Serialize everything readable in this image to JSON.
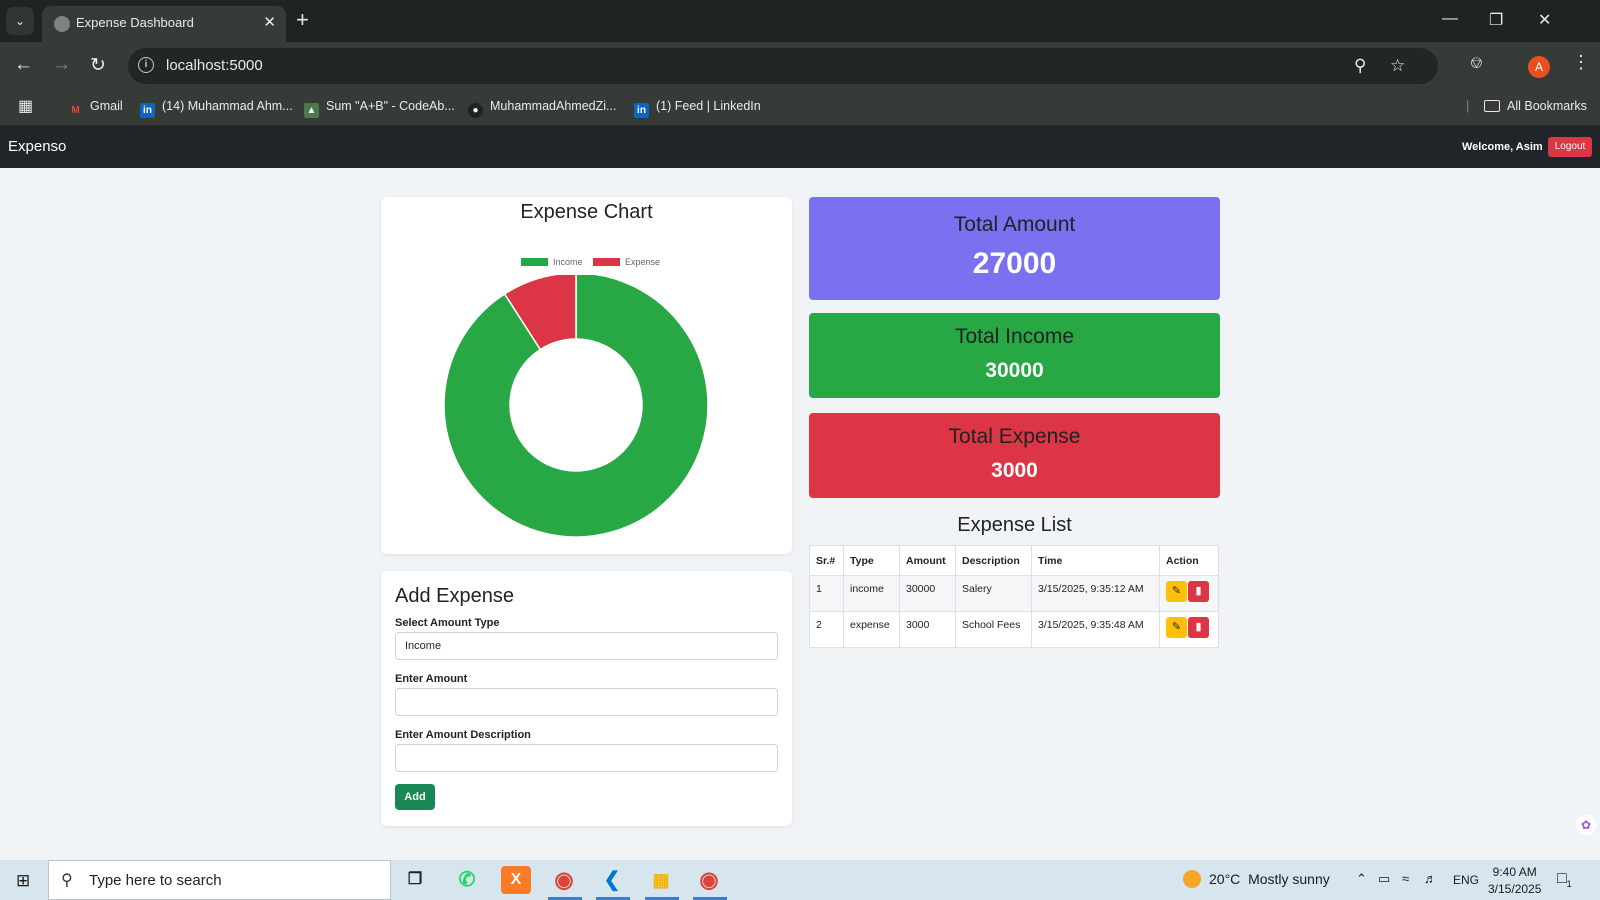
{
  "browser": {
    "tab_title": "Expense Dashboard",
    "url": "localhost:5000",
    "profile_initial": "A",
    "bookmarks": [
      {
        "label": "Gmail",
        "icon": "gmail-icon"
      },
      {
        "label": "(14) Muhammad Ahm...",
        "icon": "linkedin-icon"
      },
      {
        "label": "Sum \"A+B\" - CodeAb...",
        "icon": "codeabbey-icon"
      },
      {
        "label": "MuhammadAhmedZi...",
        "icon": "github-icon"
      },
      {
        "label": "(1) Feed | LinkedIn",
        "icon": "linkedin-icon"
      }
    ],
    "all_bookmarks_label": "All Bookmarks"
  },
  "app": {
    "brand": "Expenso",
    "welcome": "Welcome, Asim",
    "logout_label": "Logout"
  },
  "chart_card": {
    "title": "Expense Chart"
  },
  "chart_data": {
    "type": "pie",
    "style": "doughnut",
    "categories": [
      "Income",
      "Expense"
    ],
    "values": [
      30000,
      3000
    ],
    "colors": [
      "#28a745",
      "#dc3545"
    ],
    "legend_position": "top"
  },
  "summary": {
    "total_amount": {
      "label": "Total Amount",
      "value": "27000",
      "color": "#7b71f0"
    },
    "total_income": {
      "label": "Total Income",
      "value": "30000",
      "color": "#28a745"
    },
    "total_expense": {
      "label": "Total Expense",
      "value": "3000",
      "color": "#dc3545"
    }
  },
  "form": {
    "title": "Add Expense",
    "type_label": "Select Amount Type",
    "type_value": "Income",
    "amount_label": "Enter Amount",
    "amount_value": "",
    "description_label": "Enter Amount Description",
    "description_value": "",
    "add_label": "Add"
  },
  "expense_list": {
    "title": "Expense List",
    "columns": [
      "Sr.#",
      "Type",
      "Amount",
      "Description",
      "Time",
      "Action"
    ],
    "rows": [
      {
        "sr": "1",
        "type": "income",
        "amount": "30000",
        "description": "Salery",
        "time": "3/15/2025, 9:35:12 AM"
      },
      {
        "sr": "2",
        "type": "expense",
        "amount": "3000",
        "description": "School Fees",
        "time": "3/15/2025, 9:35:48 AM"
      }
    ]
  },
  "taskbar": {
    "search_placeholder": "Type here to search",
    "weather_temp": "20°C",
    "weather_text": "Mostly sunny",
    "language": "ENG",
    "time": "9:40 AM",
    "date": "3/15/2025",
    "notification_count": "1"
  }
}
